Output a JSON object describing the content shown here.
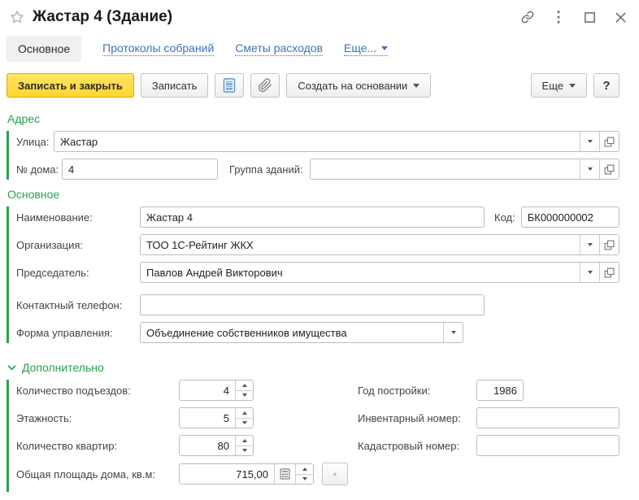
{
  "window": {
    "title": "Жастар 4 (Здание)"
  },
  "tabs": {
    "main": "Основное",
    "protocols": "Протоколы собраний",
    "estimates": "Сметы расходов",
    "more": "Еще..."
  },
  "toolbar": {
    "save_close": "Записать и закрыть",
    "save": "Записать",
    "create_based_on": "Создать на основании",
    "more": "Еще",
    "help": "?"
  },
  "address": {
    "title": "Адрес",
    "street_label": "Улица:",
    "street_value": "Жастар",
    "house_label": "№ дома:",
    "house_value": "4",
    "group_label": "Группа зданий:",
    "group_value": ""
  },
  "main": {
    "title": "Основное",
    "name_label": "Наименование:",
    "name_value": "Жастар 4",
    "code_label": "Код:",
    "code_value": "БК000000002",
    "org_label": "Организация:",
    "org_value": "ТОО 1С-Рейтинг ЖКХ",
    "chairman_label": "Председатель:",
    "chairman_value": "Павлов Андрей Викторович",
    "phone_label": "Контактный телефон:",
    "phone_value": "",
    "mgmt_label": "Форма управления:",
    "mgmt_value": "Объединение собственников имущества"
  },
  "additional": {
    "title": "Дополнительно",
    "entrances_label": "Количество подъездов:",
    "entrances_value": "4",
    "floors_label": "Этажность:",
    "floors_value": "5",
    "apartments_label": "Количество квартир:",
    "apartments_value": "80",
    "area_label": "Общая площадь дома, кв.м:",
    "area_value": "715,00",
    "year_label": "Год постройки:",
    "year_value": "1986",
    "inventory_label": "Инвентарный номер:",
    "inventory_value": "",
    "cadastre_label": "Кадастровый номер:",
    "cadastre_value": ""
  },
  "colors": {
    "accent_green": "#28a050",
    "button_yellow": "#ffd430",
    "link_blue": "#3b73b9"
  }
}
